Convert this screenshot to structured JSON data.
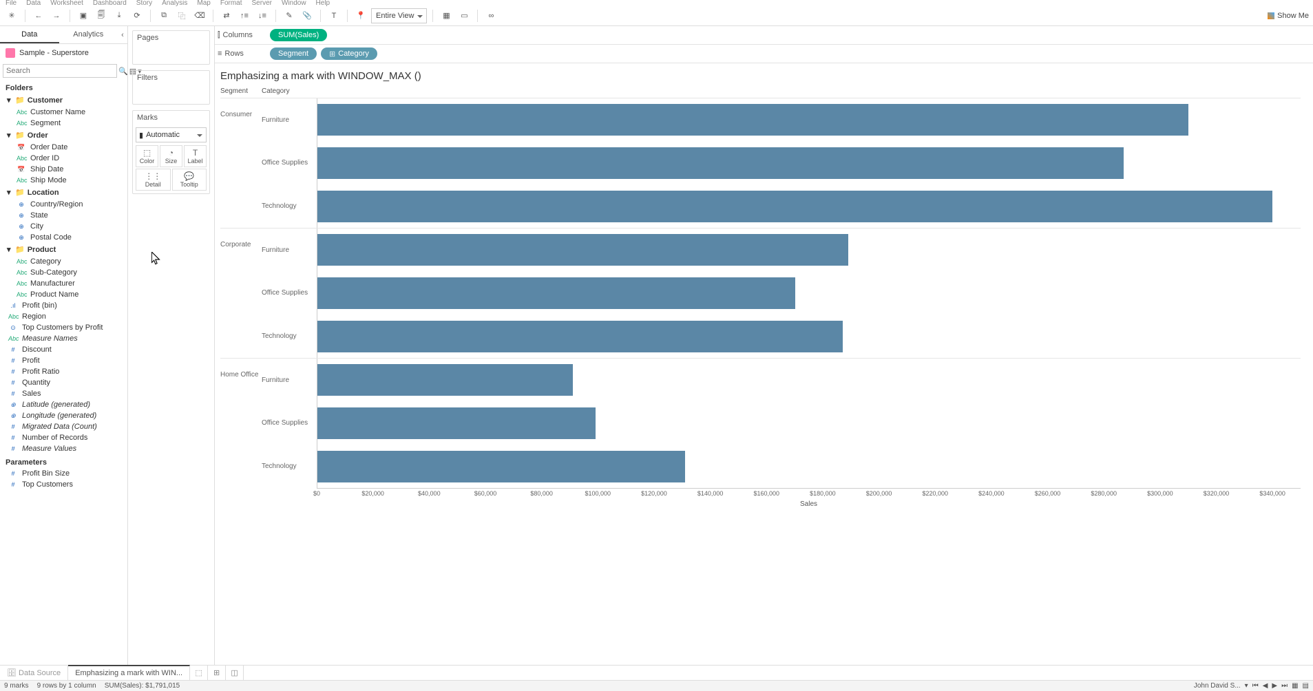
{
  "menubar": [
    "File",
    "Data",
    "Worksheet",
    "Dashboard",
    "Story",
    "Analysis",
    "Map",
    "Format",
    "Server",
    "Window",
    "Help"
  ],
  "toolbar": {
    "fit": "Entire View"
  },
  "showme": "Show Me",
  "sidebar": {
    "tabs": [
      "Data",
      "Analytics"
    ],
    "datasource": "Sample - Superstore",
    "search_placeholder": "Search",
    "folders_header": "Folders",
    "folders": [
      {
        "name": "Customer",
        "fields": [
          {
            "type": "Abc",
            "label": "Customer Name"
          },
          {
            "type": "Abc",
            "label": "Segment"
          }
        ]
      },
      {
        "name": "Order",
        "fields": [
          {
            "type": "date",
            "label": "Order Date"
          },
          {
            "type": "Abc",
            "label": "Order ID"
          },
          {
            "type": "date",
            "label": "Ship Date"
          },
          {
            "type": "Abc",
            "label": "Ship Mode"
          }
        ]
      },
      {
        "name": "Location",
        "fields": [
          {
            "type": "geo",
            "label": "Country/Region"
          },
          {
            "type": "geo",
            "label": "State"
          },
          {
            "type": "geo",
            "label": "City"
          },
          {
            "type": "geo",
            "label": "Postal Code"
          }
        ]
      },
      {
        "name": "Product",
        "fields": [
          {
            "type": "Abc",
            "label": "Category"
          },
          {
            "type": "Abc",
            "label": "Sub-Category"
          },
          {
            "type": "Abc",
            "label": "Manufacturer"
          },
          {
            "type": "Abc",
            "label": "Product Name"
          }
        ]
      }
    ],
    "loose_fields": [
      {
        "type": "bin",
        "label": "Profit (bin)"
      },
      {
        "type": "Abc",
        "label": "Region"
      },
      {
        "type": "set",
        "label": "Top Customers by Profit"
      },
      {
        "type": "Abc",
        "label": "Measure Names",
        "italic": true
      },
      {
        "type": "num",
        "label": "Discount"
      },
      {
        "type": "num",
        "label": "Profit"
      },
      {
        "type": "num",
        "label": "Profit Ratio"
      },
      {
        "type": "num",
        "label": "Quantity"
      },
      {
        "type": "num",
        "label": "Sales"
      },
      {
        "type": "geo",
        "label": "Latitude (generated)",
        "italic": true
      },
      {
        "type": "geo",
        "label": "Longitude (generated)",
        "italic": true
      },
      {
        "type": "num",
        "label": "Migrated Data (Count)",
        "italic": true
      },
      {
        "type": "num",
        "label": "Number of Records"
      },
      {
        "type": "num",
        "label": "Measure Values",
        "italic": true
      }
    ],
    "parameters_header": "Parameters",
    "parameters": [
      {
        "type": "num",
        "label": "Profit Bin Size"
      },
      {
        "type": "num",
        "label": "Top Customers"
      }
    ]
  },
  "shelves": {
    "pages": "Pages",
    "filters": "Filters",
    "marks": "Marks",
    "marks_type": "Automatic",
    "marks_cells": [
      "Color",
      "Size",
      "Label",
      "Detail",
      "Tooltip"
    ]
  },
  "colrow": {
    "columns_label": "Columns",
    "rows_label": "Rows",
    "columns_pill": "SUM(Sales)",
    "rows_pills": [
      "Segment",
      "Category"
    ]
  },
  "worksheet_title": "Emphasizing a mark with WINDOW_MAX ()",
  "chart_headers": {
    "c1": "Segment",
    "c2": "Category"
  },
  "chart_data": {
    "type": "bar",
    "orientation": "horizontal",
    "xlabel": "Sales",
    "xlim": [
      0,
      350000
    ],
    "color": "#5b87a6",
    "x_ticks": [
      "$0",
      "$20,000",
      "$40,000",
      "$60,000",
      "$80,000",
      "$100,000",
      "$120,000",
      "$140,000",
      "$160,000",
      "$180,000",
      "$200,000",
      "$220,000",
      "$240,000",
      "$260,000",
      "$280,000",
      "$300,000",
      "$320,000",
      "$340,000"
    ],
    "segments": [
      {
        "segment": "Consumer",
        "rows": [
          {
            "category": "Furniture",
            "value": 310000
          },
          {
            "category": "Office Supplies",
            "value": 287000
          },
          {
            "category": "Technology",
            "value": 340000
          }
        ]
      },
      {
        "segment": "Corporate",
        "rows": [
          {
            "category": "Furniture",
            "value": 189000
          },
          {
            "category": "Office Supplies",
            "value": 170000
          },
          {
            "category": "Technology",
            "value": 187000
          }
        ]
      },
      {
        "segment": "Home Office",
        "rows": [
          {
            "category": "Furniture",
            "value": 91000
          },
          {
            "category": "Office Supplies",
            "value": 99000
          },
          {
            "category": "Technology",
            "value": 131000
          }
        ]
      }
    ]
  },
  "sheet_tabs": {
    "ds": "Data Source",
    "active": "Emphasizing a mark with WIN..."
  },
  "status": {
    "marks": "9 marks",
    "rowcol": "9 rows by 1 column",
    "agg": "SUM(Sales): $1,791,015",
    "user": "John David S..."
  }
}
